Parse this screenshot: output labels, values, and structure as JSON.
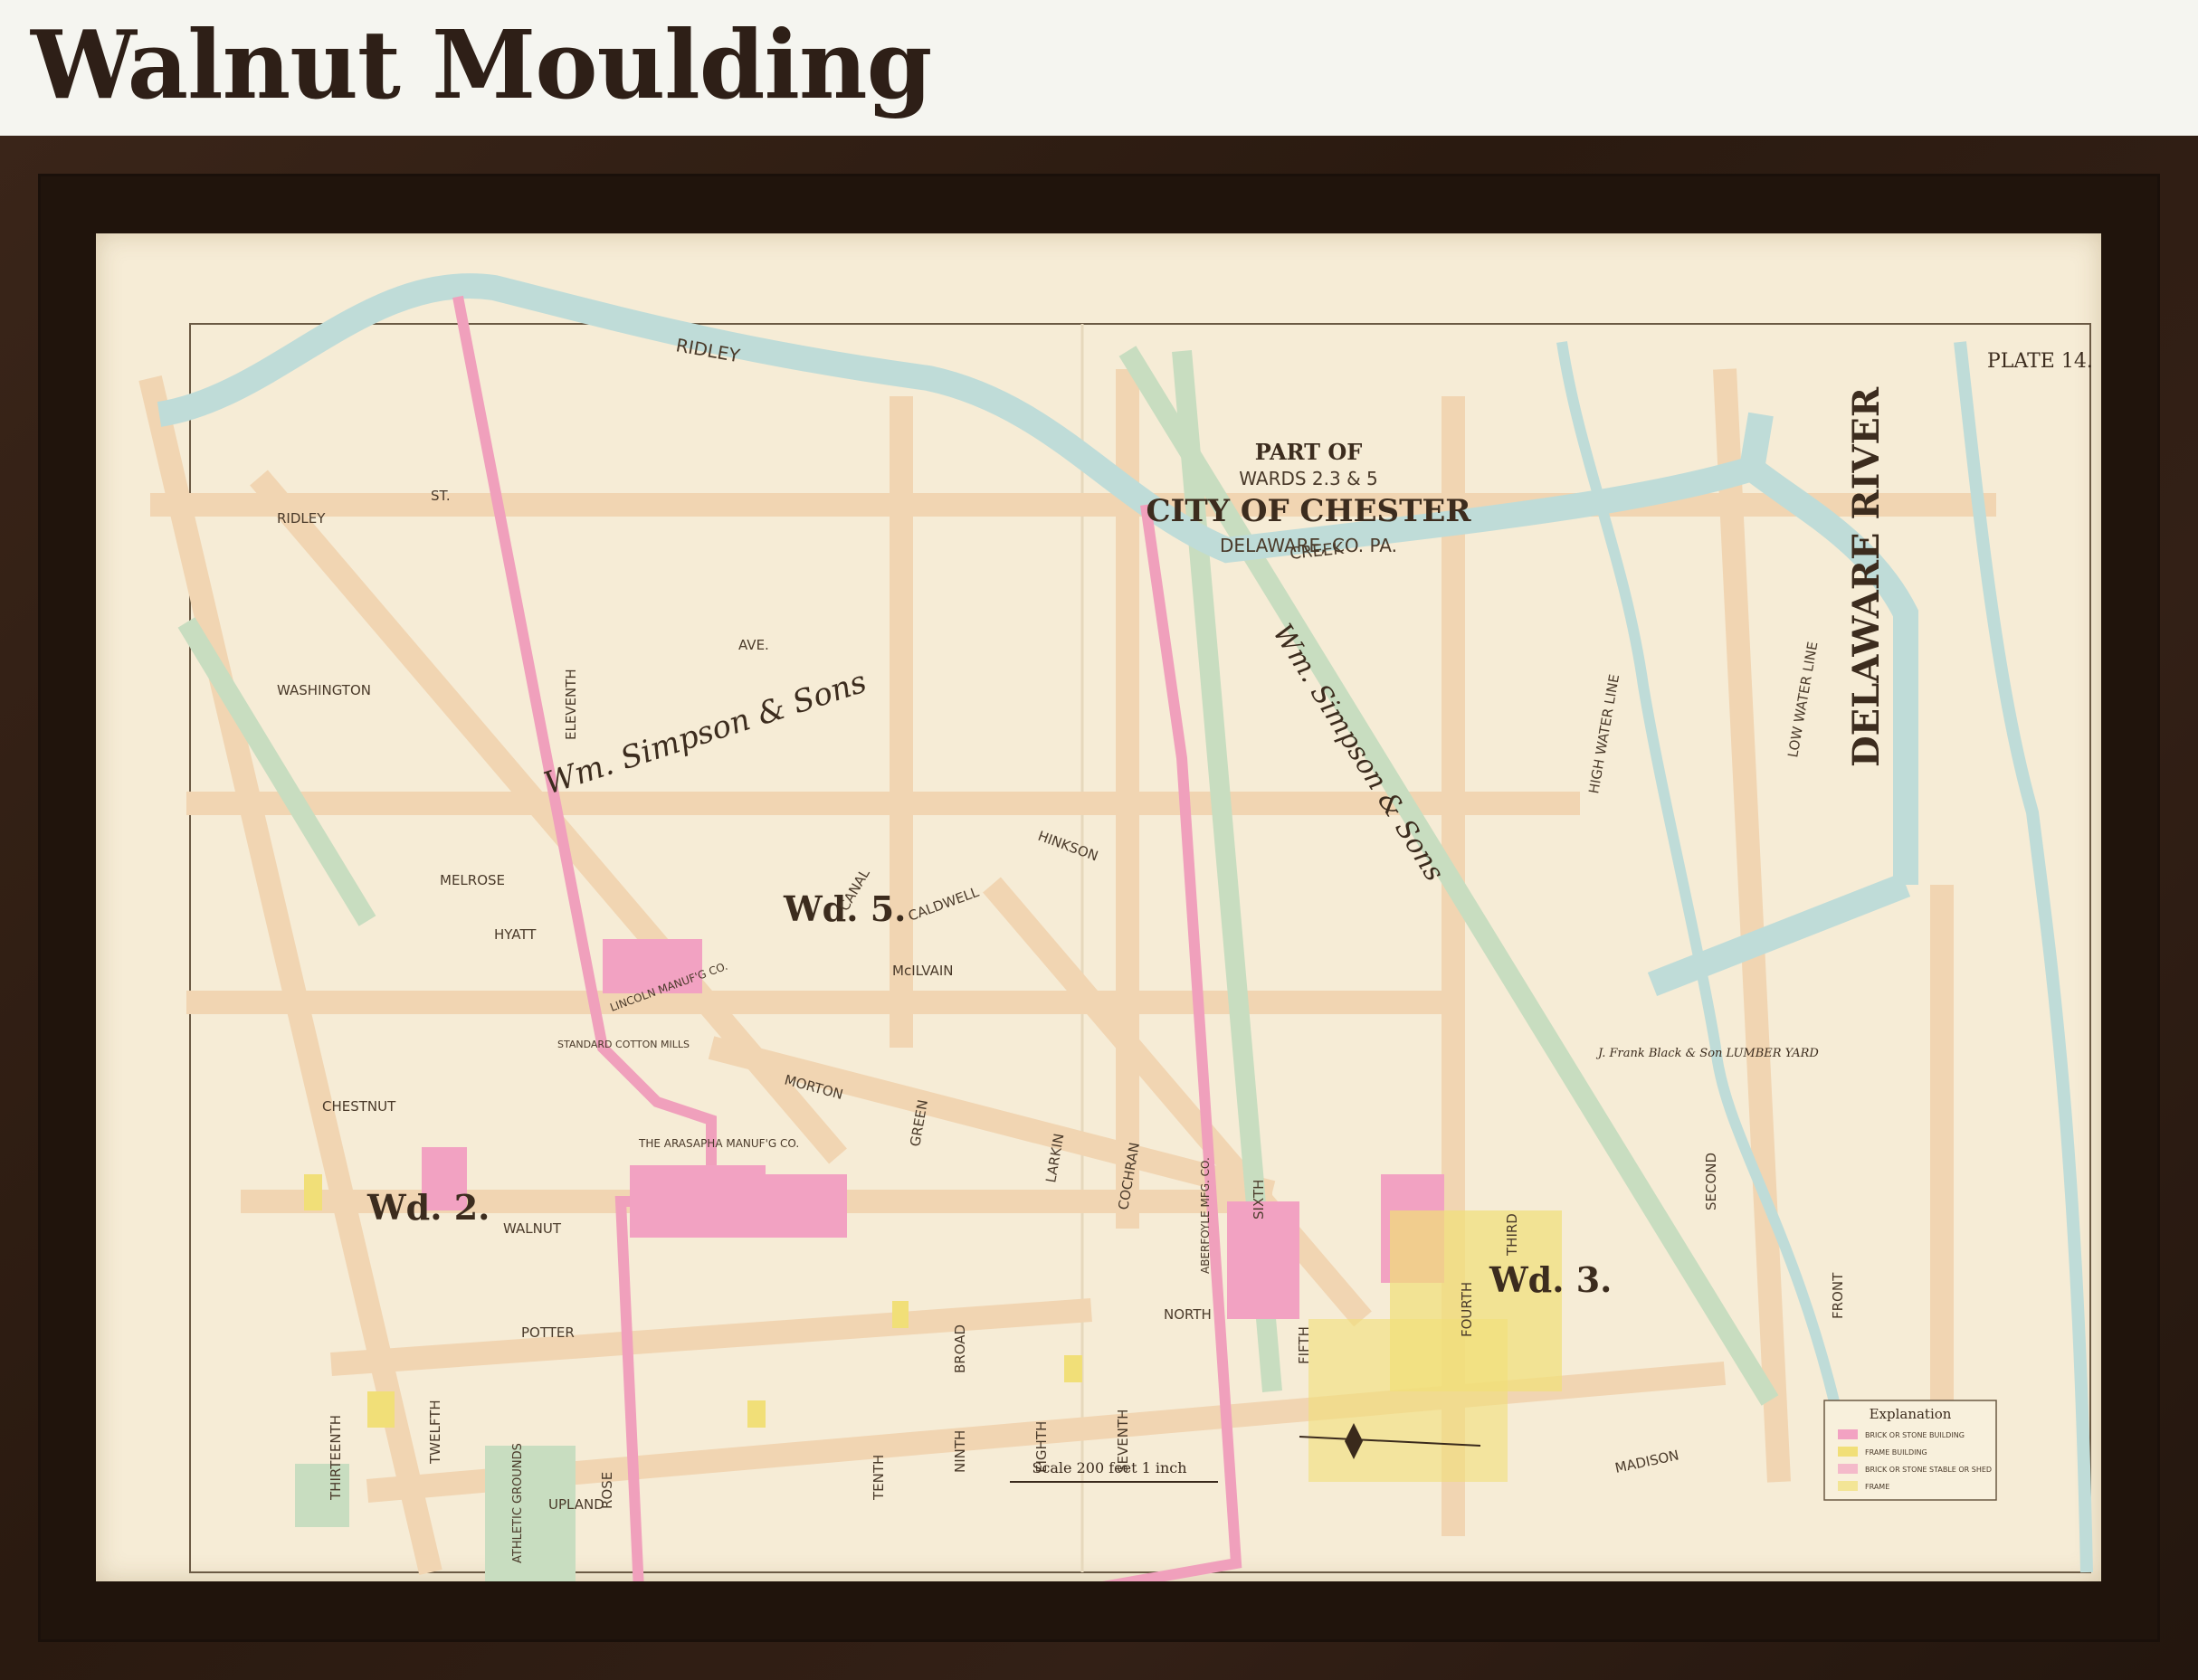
{
  "page": {
    "title": "Walnut Moulding"
  },
  "map": {
    "plate": "PLATE 14.",
    "title_part": "PART OF",
    "title_wards": "WARDS 2.3 & 5",
    "title_city": "CITY OF CHESTER",
    "title_county": "DELAWARE, CO. PA.",
    "wards": [
      "Wd. 5.",
      "Wd. 2.",
      "Wd. 3."
    ],
    "river": "DELAWARE RIVER",
    "creek": [
      "RIDLEY",
      "CREEK"
    ],
    "owners": [
      "Wm. Simpson & Sons",
      "Wm. Simpson & Sons"
    ],
    "mills": [
      "STANDARD COTTON MILLS",
      "THE ARASAPHA MANUF'G CO.",
      "ABERFOYLE MFG. CO.",
      "LINCOLN MANUF'G CO.",
      "ATHLETIC GROUNDS",
      "J. Frank Black & Son LUMBER YARD"
    ],
    "streets": {
      "ridley": "RIDLEY",
      "st1": "ST.",
      "ave1": "AVE.",
      "washington": "WASHINGTON",
      "melrose": "MELROSE",
      "hyatt": "HYATT",
      "chestnut": "CHESTNUT",
      "walnut": "WALNUT",
      "potter": "POTTER",
      "upland": "UPLAND",
      "morton": "MORTON",
      "caldwell": "CALDWELL",
      "hinkson": "HINKSON",
      "madison": "MADISON",
      "front": "FRONT",
      "second": "SECOND",
      "third": "THIRD",
      "fourth": "FOURTH",
      "fifth": "FIFTH",
      "sixth": "SIXTH",
      "seventh": "SEVENTH",
      "eighth": "EIGHTH",
      "ninth": "NINTH",
      "tenth": "TENTH",
      "twelfth": "TWELFTH",
      "thirteenth": "THIRTEENTH",
      "eleventh": "ELEVENTH",
      "rose": "ROSE",
      "cochran": "COCHRAN",
      "larkin": "LARKIN",
      "green": "GREEN",
      "canal": "CANAL",
      "mcilvain": "McILVAIN",
      "north": "NORTH",
      "broad": "BROAD",
      "high_water": "HIGH WATER LINE",
      "low_water": "LOW WATER LINE"
    },
    "scale": "Scale 200 feet 1 inch",
    "legend": {
      "title": "Explanation",
      "items": [
        "BRICK OR STONE BUILDING",
        "FRAME BUILDING",
        "BRICK OR STONE STABLE OR SHED",
        "FRAME"
      ]
    },
    "colors": {
      "paper": "#f6ecd6",
      "street": "#f3d8b8",
      "rail": "#c8ddc0",
      "water": "#bfdcd8",
      "ward_border": "#f0a0bc",
      "brick": "#f2a2c2",
      "frame": "#f1df78"
    }
  }
}
